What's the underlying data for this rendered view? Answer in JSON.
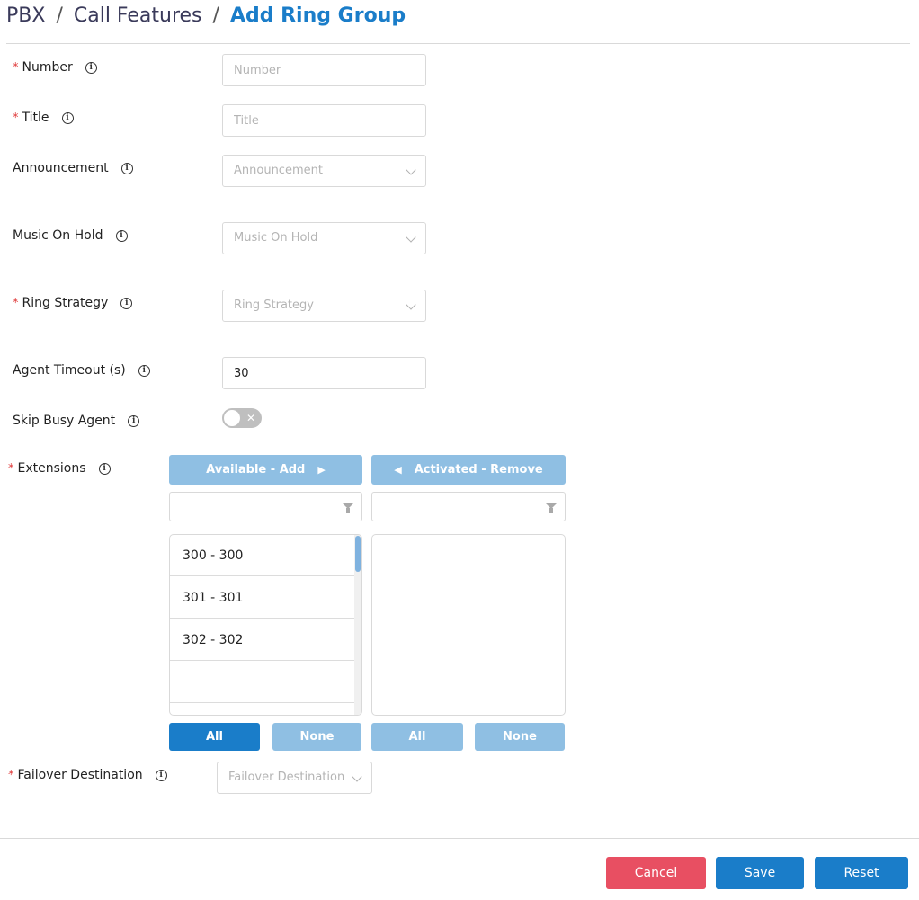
{
  "breadcrumb": {
    "items": [
      "PBX",
      "Call Features"
    ],
    "separator": "/",
    "current": "Add Ring Group"
  },
  "form": {
    "number": {
      "label": "Number",
      "required": true,
      "placeholder": "Number",
      "value": ""
    },
    "title": {
      "label": "Title",
      "required": true,
      "placeholder": "Title",
      "value": ""
    },
    "announcement": {
      "label": "Announcement",
      "required": false,
      "placeholder": "Announcement"
    },
    "music_on_hold": {
      "label": "Music On Hold",
      "required": false,
      "placeholder": "Music On Hold"
    },
    "ring_strategy": {
      "label": "Ring Strategy",
      "required": true,
      "placeholder": "Ring Strategy"
    },
    "agent_timeout": {
      "label": "Agent Timeout (s)",
      "required": false,
      "value": "30"
    },
    "skip_busy_agent": {
      "label": "Skip Busy Agent",
      "required": false,
      "enabled": false
    },
    "extensions": {
      "label": "Extensions",
      "required": true,
      "available_header": "Available - Add",
      "activated_header": "Activated - Remove",
      "available_items": [
        "300 - 300",
        "301 - 301",
        "302 - 302",
        ""
      ],
      "activated_items": [],
      "all_label": "All",
      "none_label": "None"
    },
    "failover_destination": {
      "label": "Failover Destination",
      "required": true,
      "placeholder": "Failover Destination"
    }
  },
  "info_glyph": "i",
  "required_mark": "*",
  "footer": {
    "cancel": "Cancel",
    "save": "Save",
    "reset": "Reset"
  },
  "colors": {
    "primary": "#1a7dc9",
    "light_primary": "#8fbfe3",
    "danger": "#e84f62",
    "required": "#e03c3c"
  }
}
